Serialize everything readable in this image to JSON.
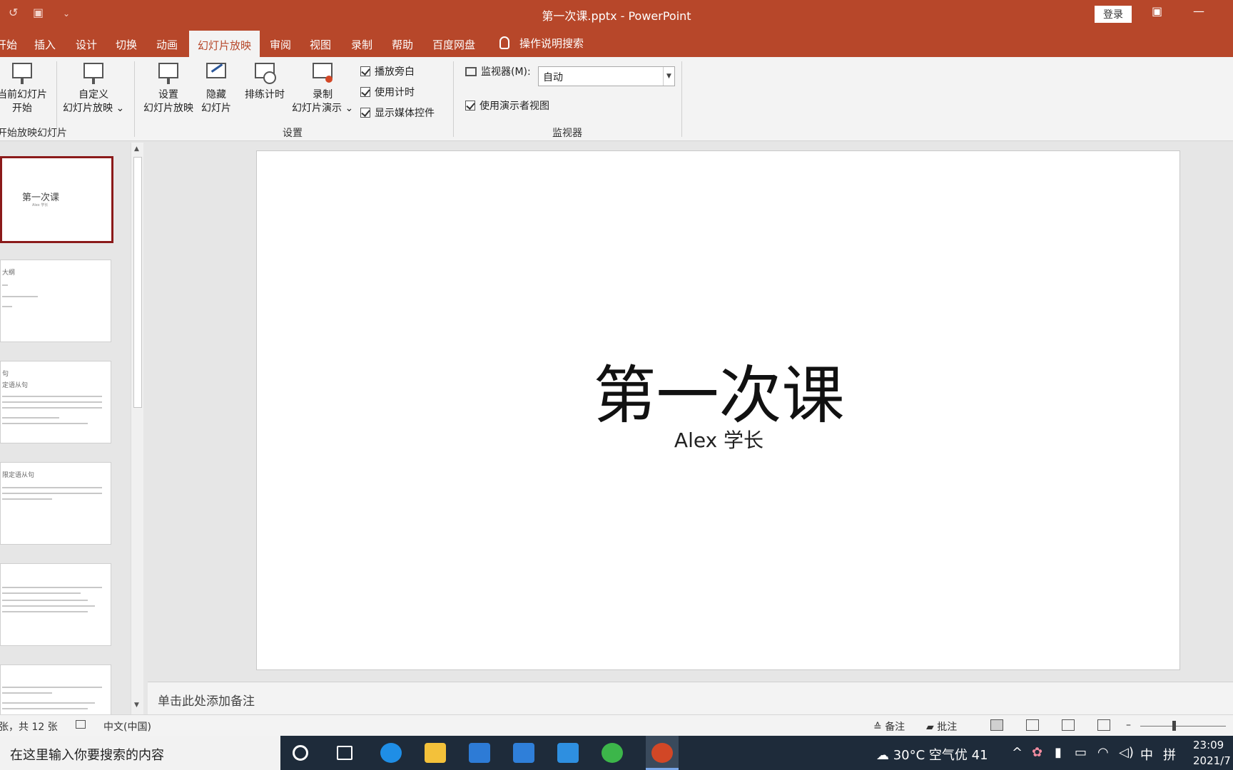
{
  "titlebar": {
    "title": "第一次课.pptx  -  PowerPoint",
    "login": "登录",
    "qa_undo": "↺",
    "qa_present": "▣",
    "qa_more": "⌄",
    "restore_icon": "▣",
    "minimize_icon": "—"
  },
  "tabs": {
    "items": [
      "开始",
      "插入",
      "设计",
      "切换",
      "动画",
      "幻灯片放映",
      "审阅",
      "视图",
      "录制",
      "帮助",
      "百度网盘"
    ],
    "active": "幻灯片放映",
    "tell_me": "操作说明搜索"
  },
  "ribbon": {
    "from_current": [
      "当前幻灯片",
      "开始"
    ],
    "custom_show": [
      "自定义",
      "幻灯片放映 ⌄"
    ],
    "start_group": "开始放映幻灯片",
    "setup_show": [
      "设置",
      "幻灯片放映"
    ],
    "hide_slide": [
      "隐藏",
      "幻灯片"
    ],
    "rehearse": "排练计时",
    "record": [
      "录制",
      "幻灯片演示 ⌄"
    ],
    "checks": [
      "播放旁白",
      "使用计时",
      "显示媒体控件"
    ],
    "setup_group": "设置",
    "monitor_label": "监视器(M):",
    "monitor_value": "自动",
    "presenter_view": "使用演示者视图",
    "monitor_group": "监视器"
  },
  "thumbnails": {
    "slide1_title": "第一次课",
    "slide1_sub": "Alex 学长",
    "slide2_title": "大纲",
    "slide3_title": "句",
    "slide3_sub": "定语从句",
    "slide4_title": "限定语从句"
  },
  "slide": {
    "title": "第一次课",
    "subtitle": "Alex 学长"
  },
  "notes": {
    "placeholder": "单击此处添加备注"
  },
  "status": {
    "slide_count": "张，共 12 张",
    "language": "中文(中国)",
    "notes": "备注",
    "comments": "批注",
    "zoom_minus": "–"
  },
  "taskbar": {
    "search": "在这里输入你要搜索的内容",
    "weather": "30°C  空气优 41",
    "ime": "中",
    "ime2": "拼",
    "time": "23:09",
    "date": "2021/7"
  }
}
